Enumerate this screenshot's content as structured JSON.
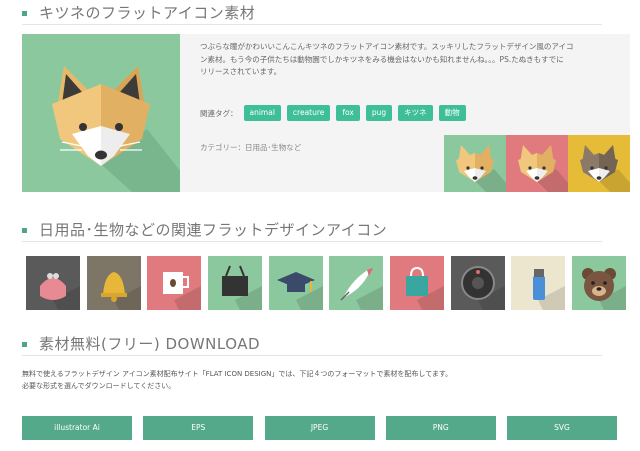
{
  "section1": {
    "title": "キツネのフラットアイコン素材"
  },
  "main": {
    "description_lines": [
      "つぶらな瞳がかわいいこんこんキツネのフラットアイコン素材です。スッキリしたフラットデザイン風のアイコ",
      "ン素材。もう今の子供たちは動物園でしかキツネをみる機会はないかも知れませんね。。。PS.たぬきもすでに",
      "リリースされています。"
    ],
    "tags_label": "関連タグ：",
    "tags": [
      "animal",
      "creature",
      "fox",
      "pug",
      "キツネ",
      "動物"
    ],
    "category_line": "カテゴリー：日用品･生物など",
    "hero_bg": "#8bc89e",
    "variants": [
      {
        "bg": "#8bc89e",
        "name": "fox-icon-green-variant"
      },
      {
        "bg": "#e07a7e",
        "name": "fox-icon-red-variant"
      },
      {
        "bg": "#e5bb38",
        "name": "fox-icon-yellow-variant"
      }
    ]
  },
  "section2": {
    "title": "日用品･生物などの関連フラットデザインアイコン"
  },
  "related_icons": [
    {
      "name": "coin-purse-icon",
      "bg": "#5a5a5a"
    },
    {
      "name": "bell-icon",
      "bg": "#7d7566"
    },
    {
      "name": "coffee-cup-icon",
      "bg": "#e07a7e"
    },
    {
      "name": "binder-clip-icon",
      "bg": "#8bc89e"
    },
    {
      "name": "graduation-cap-icon",
      "bg": "#8bc89e"
    },
    {
      "name": "quill-pen-icon",
      "bg": "#8bc89e"
    },
    {
      "name": "shopping-bag-icon",
      "bg": "#e07a7e"
    },
    {
      "name": "robot-vacuum-icon",
      "bg": "#5a5a5a"
    },
    {
      "name": "lighter-icon",
      "bg": "#ece6cf"
    },
    {
      "name": "bear-icon",
      "bg": "#8bc89e"
    }
  ],
  "section3": {
    "title": "素材無料(フリー) DOWNLOAD"
  },
  "download": {
    "description_lines": [
      "無料で使えるフラットデザイン アイコン素材配布サイト「FLAT ICON DESIGN」では、下記４つのフォーマットで素材を配布してます。",
      "必要な形式を選んでダウンロードしてください。"
    ],
    "buttons": [
      "illustrator Ai",
      "EPS",
      "JPEG",
      "PNG",
      "SVG"
    ]
  }
}
